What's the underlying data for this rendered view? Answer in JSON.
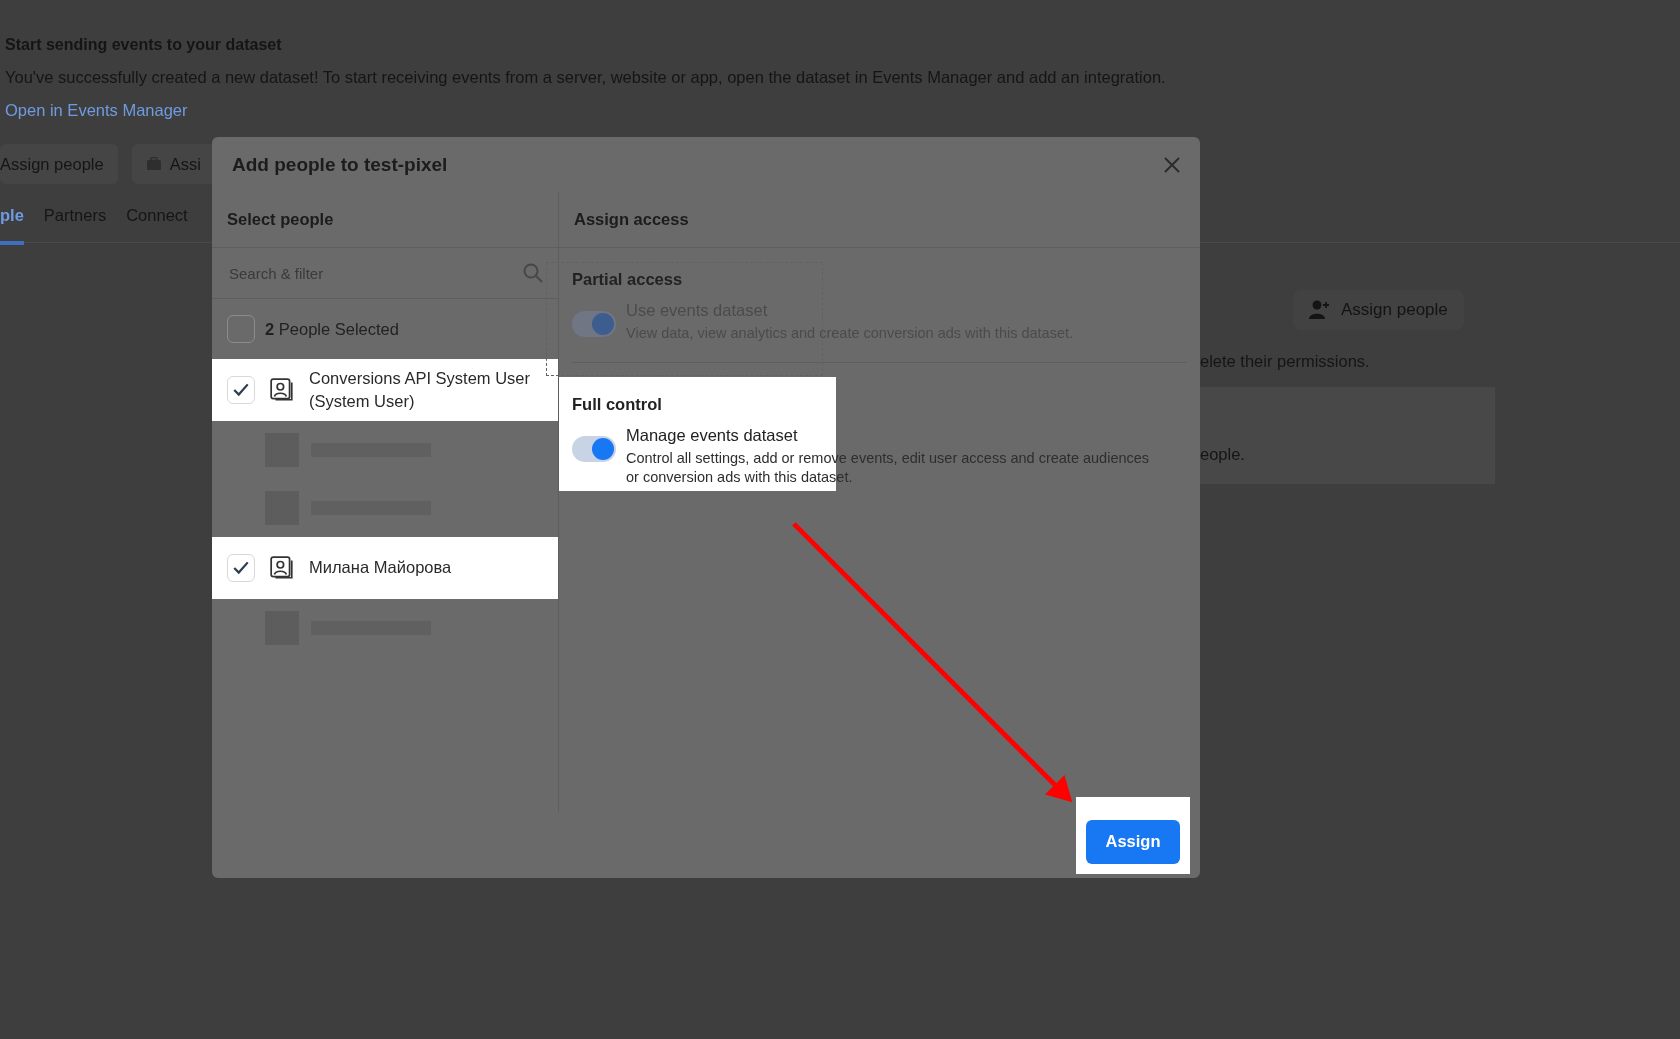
{
  "page": {
    "heading": "Start sending events to your dataset",
    "message": "You've successfully created a new dataset! To start receiving events from a server, website or app, open the dataset in Events Manager and add an integration.",
    "link": "Open in Events Manager",
    "buttons": [
      {
        "label": "Assign people",
        "kind": "plain"
      },
      {
        "label": "Assi",
        "kind": "briefcase"
      }
    ],
    "tabs": [
      {
        "label": "ple",
        "selected": true
      },
      {
        "label": "Partners",
        "selected": false
      },
      {
        "label": "Connect",
        "selected": false
      }
    ],
    "side_button": "Assign people",
    "notes": [
      "elete their permissions.",
      "eople."
    ]
  },
  "dialog": {
    "title": "Add people to test-pixel",
    "left_header": "Select people",
    "search": {
      "placeholder": "Search & filter"
    },
    "selection": {
      "label": "**2** People Selected",
      "checked": false
    },
    "people": [
      {
        "kind": "person",
        "name": "Conversions API System User (System User)",
        "checked": true,
        "highlighted": true
      },
      {
        "kind": "redacted"
      },
      {
        "kind": "redacted"
      },
      {
        "kind": "person",
        "name": "Милана Майорова",
        "checked": true,
        "highlighted": true
      },
      {
        "kind": "redacted"
      }
    ],
    "right_header": "Assign access",
    "sections": [
      {
        "title": "Partial access",
        "highlighted": false,
        "name": "Use events dataset",
        "description": "View data, view analytics and create conversion ads with this dataset.",
        "on": true,
        "disabled": true
      },
      {
        "title": "Full control",
        "highlighted": true,
        "name": "Manage events dataset",
        "description": "Control all settings, add or remove events, edit user access and create audiences or conversion ads with this dataset.",
        "on": true,
        "disabled": false
      }
    ],
    "assign_button": "Assign"
  }
}
